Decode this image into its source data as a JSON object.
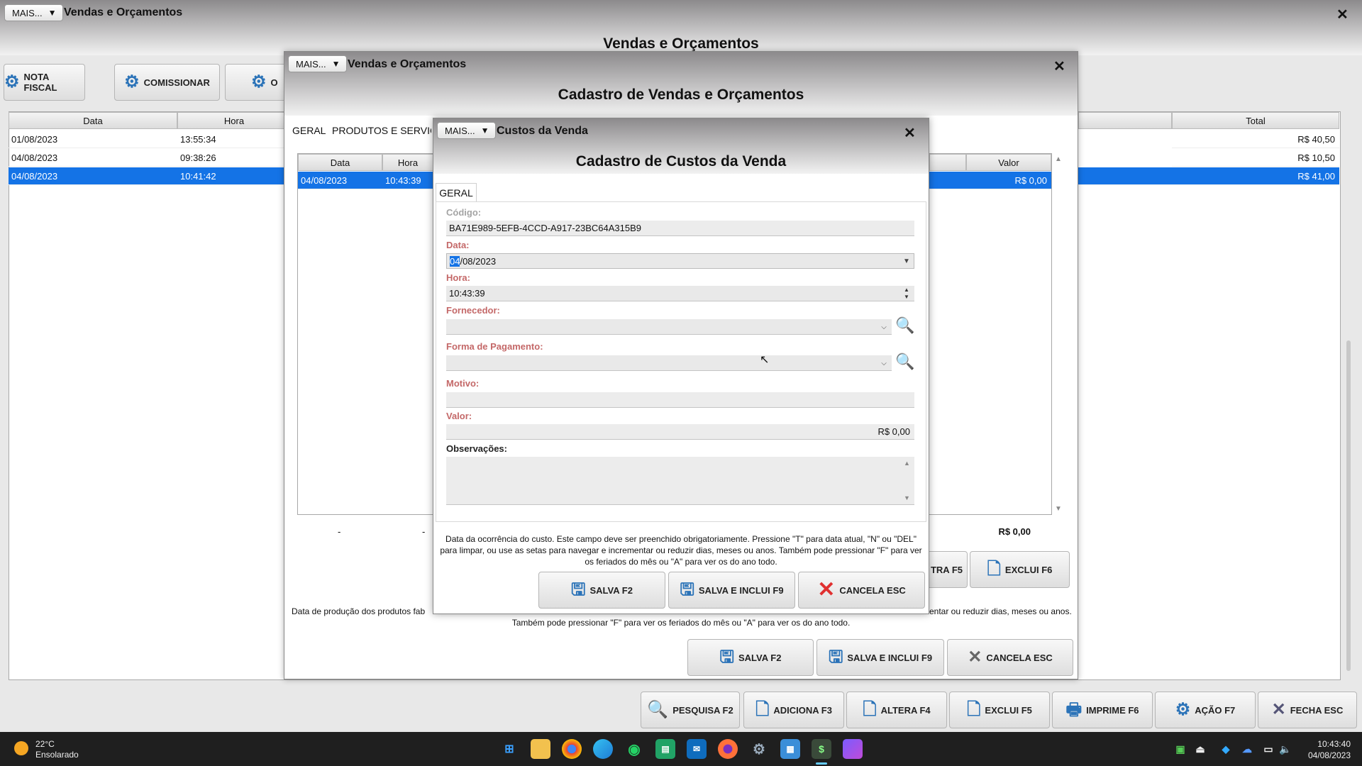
{
  "main": {
    "more_label": "MAIS...",
    "title": "Vendas e Orçamentos",
    "heading": "Vendas e Orçamentos",
    "close": "✕",
    "top_buttons": [
      {
        "label": "NOTA FISCAL",
        "icon": "gear-icon"
      },
      {
        "label": "COMISSIONAR",
        "icon": "gear-icon"
      },
      {
        "label": "O",
        "icon": "gear-icon"
      }
    ],
    "columns": {
      "data": "Data",
      "hora": "Hora",
      "total": "Total"
    },
    "rows": [
      {
        "data": "01/08/2023",
        "hora": "13:55:34",
        "total": "R$ 40,50"
      },
      {
        "data": "04/08/2023",
        "hora": "09:38:26",
        "total": "R$ 10,50"
      },
      {
        "data": "04/08/2023",
        "hora": "10:41:42",
        "total": "R$ 41,00"
      }
    ],
    "bottom_buttons": [
      {
        "label": "PESQUISA F2",
        "icon": "search-icon"
      },
      {
        "label": "ADICIONA F3",
        "icon": "document-add-icon"
      },
      {
        "label": "ALTERA F4",
        "icon": "document-edit-icon"
      },
      {
        "label": "EXCLUI F5",
        "icon": "document-delete-icon"
      },
      {
        "label": "IMPRIME F6",
        "icon": "printer-icon"
      },
      {
        "label": "AÇÃO F7",
        "icon": "gear-icon"
      },
      {
        "label": "FECHA ESC",
        "icon": "close-icon"
      }
    ]
  },
  "sale": {
    "more_label": "MAIS...",
    "title": "Vendas e Orçamentos",
    "heading": "Cadastro de Vendas e Orçamentos",
    "close": "✕",
    "tabs": [
      "GERAL",
      "PRODUTOS E SERVIÇOS"
    ],
    "columns": {
      "data": "Data",
      "hora": "Hora",
      "valor": "Valor"
    },
    "row": {
      "data": "04/08/2023",
      "hora": "10:43:39",
      "valor": "R$ 0,00"
    },
    "footer": {
      "dash1": "-",
      "dash2": "-",
      "total": "R$ 0,00"
    },
    "side_buttons": [
      {
        "label": "ALTERA F5",
        "visible": "TRA F5"
      },
      {
        "label": "EXCLUI F6"
      }
    ],
    "hint_line1_left": "Data de produção dos produtos fabricados, caso existir. Pressione \"T\" para data atual, \"N\" ou \"DEL\" para limpar, ou use as setas para navegar e incrementar ou reduzir dias, meses ou anos.",
    "hint_line1_a": "Data de produção dos produtos fab",
    "hint_line1_b": "mentar ou reduzir dias, meses ou anos.",
    "hint_line2": "Também pode pressionar \"F\" para ver os feriados do mês ou \"A\" para ver os do ano todo.",
    "buttons": [
      {
        "label": "SALVA F2"
      },
      {
        "label": "SALVA E INCLUI F9"
      },
      {
        "label": "CANCELA ESC"
      }
    ]
  },
  "cost": {
    "more_label": "MAIS...",
    "title": "Custos da Venda",
    "heading": "Cadastro de Custos da Venda",
    "close": "✕",
    "tab": "GERAL",
    "codigo_label": "Código:",
    "codigo_value": "BA71E989-5EFB-4CCD-A917-23BC64A315B9",
    "data_label": "Data:",
    "data_value_sel": "04",
    "data_value_rest": "/08/2023",
    "hora_label": "Hora:",
    "hora_value": "10:43:39",
    "fornecedor_label": "Fornecedor:",
    "forma_label": "Forma de Pagamento:",
    "motivo_label": "Motivo:",
    "valor_label": "Valor:",
    "valor_value": "R$ 0,00",
    "obs_label": "Observações:",
    "hint": "Data da ocorrência do custo. Este campo deve ser preenchido obrigatoriamente. Pressione \"T\" para data atual, \"N\" ou \"DEL\" para limpar, ou use as setas para navegar e incrementar ou reduzir dias, meses ou anos. Também pode pressionar \"F\" para ver os feriados do mês ou \"A\" para ver os do ano todo.",
    "buttons": [
      {
        "label": "SALVA F2"
      },
      {
        "label": "SALVA E INCLUI F9"
      },
      {
        "label": "CANCELA ESC"
      }
    ]
  },
  "taskbar": {
    "weather_temp": "22°C",
    "weather_desc": "Ensolarado",
    "time": "10:43:40",
    "date": "04/08/2023"
  }
}
